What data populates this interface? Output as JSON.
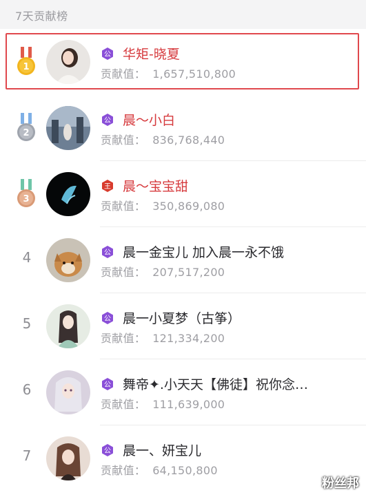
{
  "header": {
    "title": "7天贡献榜"
  },
  "label_contribution": "贡献值：",
  "rows": [
    {
      "rank": "1",
      "name": "华矩-晓夏",
      "value": "1,657,510,800",
      "badge": "公",
      "highlight": true,
      "medal": "gold"
    },
    {
      "rank": "2",
      "name": "晨～小白",
      "value": "836,768,440",
      "badge": "公",
      "highlight": false,
      "medal": "silver"
    },
    {
      "rank": "3",
      "name": "晨～宝宝甜",
      "value": "350,869,080",
      "badge": "王",
      "highlight": false,
      "medal": "bronze"
    },
    {
      "rank": "4",
      "name": "晨一金宝儿 加入晨一永不饿",
      "value": "207,517,200",
      "badge": "公"
    },
    {
      "rank": "5",
      "name": "晨一小夏梦（古筝）",
      "value": "121,334,200",
      "badge": "公"
    },
    {
      "rank": "6",
      "name": "舞帝✦.小天天【佛徒】祝你念…",
      "value": "111,639,000",
      "badge": "公"
    },
    {
      "rank": "7",
      "name": "晨一、妍宝儿",
      "value": "64,150,800",
      "badge": "公"
    }
  ],
  "watermark": "粉丝邦",
  "colors": {
    "top_name": "#d63a3d",
    "badge_purple": "#8a4fd8",
    "badge_red": "#d83b2d",
    "highlight_border": "#e0474c"
  }
}
